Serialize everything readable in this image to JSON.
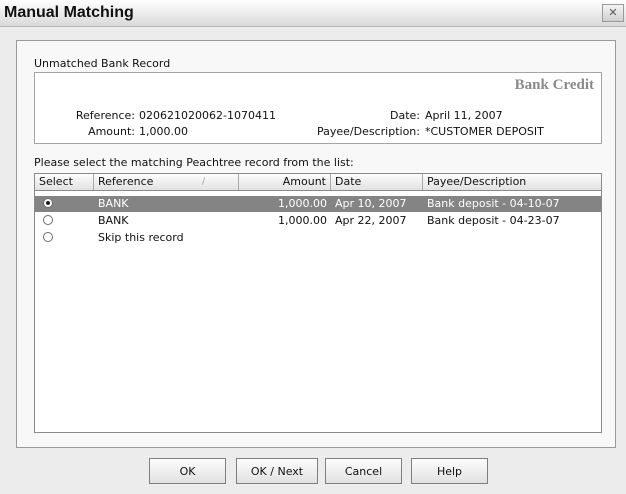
{
  "window": {
    "title": "Manual Matching",
    "close_label": "✕"
  },
  "record": {
    "group_label": "Unmatched Bank Record",
    "type_label": "Bank Credit",
    "reference_label": "Reference:",
    "reference_value": "020621020062-1070411",
    "amount_label": "Amount:",
    "amount_value": "1,000.00",
    "date_label": "Date:",
    "date_value": "April 11, 2007",
    "payee_label": "Payee/Description:",
    "payee_value": "*CUSTOMER DEPOSIT"
  },
  "list": {
    "prompt": "Please select the matching Peachtree record from the list:",
    "columns": [
      "Select",
      "Reference",
      "Amount",
      "Date",
      "Payee/Description"
    ],
    "sort_indicator": "/",
    "rows": [
      {
        "reference": "BANK",
        "amount": "1,000.00",
        "date": "Apr 10, 2007",
        "payee": "Bank deposit - 04-10-07",
        "selected": true
      },
      {
        "reference": "BANK",
        "amount": "1,000.00",
        "date": "Apr 22, 2007",
        "payee": "Bank deposit - 04-23-07",
        "selected": false
      },
      {
        "reference": "Skip this record",
        "amount": "",
        "date": "",
        "payee": "",
        "selected": false
      }
    ]
  },
  "buttons": {
    "ok": "OK",
    "ok_next": "OK / Next",
    "cancel": "Cancel",
    "help": "Help"
  },
  "colors": {
    "selected_row": "#848484",
    "window_bg": "#ececec",
    "bank_credit_text": "#8a8a8a"
  }
}
